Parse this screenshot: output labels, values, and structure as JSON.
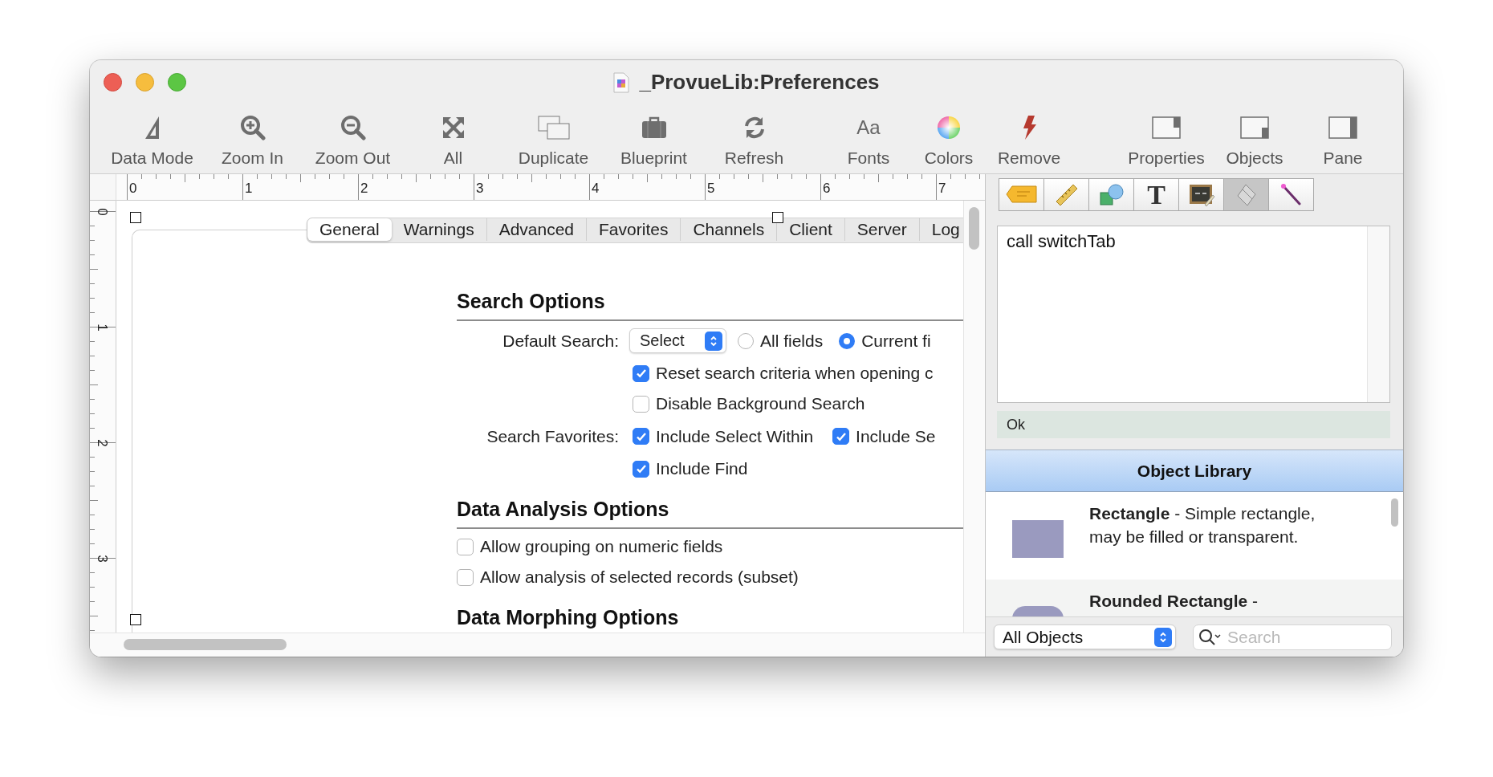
{
  "window": {
    "title": "_ProvueLib:Preferences"
  },
  "toolbar": [
    {
      "label": "Data Mode",
      "kind": "triangle"
    },
    {
      "label": "Zoom In",
      "kind": "zoom_in"
    },
    {
      "label": "Zoom Out",
      "kind": "zoom_out"
    },
    {
      "label": "All",
      "kind": "expand"
    },
    {
      "label": "Duplicate",
      "kind": "duplicate"
    },
    {
      "label": "Blueprint",
      "kind": "briefcase"
    },
    {
      "label": "Refresh",
      "kind": "refresh"
    },
    {
      "label": "Fonts",
      "kind": "fonts",
      "glyph": "Aa"
    },
    {
      "label": "Colors",
      "kind": "colors"
    },
    {
      "label": "Remove",
      "kind": "bolt"
    },
    {
      "label": "Properties",
      "kind": "pane_split"
    },
    {
      "label": "Objects",
      "kind": "pane_lower"
    },
    {
      "label": "Pane",
      "kind": "pane_full"
    }
  ],
  "rulers": {
    "horizontal": [
      "0",
      "1",
      "2",
      "3",
      "4",
      "5",
      "6",
      "7"
    ],
    "vertical": [
      "0",
      "1",
      "2",
      "3"
    ]
  },
  "form": {
    "tabs": [
      {
        "label": "General",
        "selected": true
      },
      {
        "label": "Warnings",
        "selected": false
      },
      {
        "label": "Advanced",
        "selected": false
      },
      {
        "label": "Favorites",
        "selected": false
      },
      {
        "label": "Channels",
        "selected": false
      },
      {
        "label": "Client",
        "selected": false
      },
      {
        "label": "Server",
        "selected": false
      },
      {
        "label": "Log",
        "selected": false
      }
    ],
    "sections": [
      {
        "title": "Search Options",
        "kind": "labeled",
        "rows": [
          {
            "label": "Default Search:",
            "popup": "Select",
            "radios": [
              {
                "label": "All fields",
                "selected": false
              },
              {
                "label": "Current fi",
                "selected": true
              }
            ]
          },
          {
            "checks": [
              {
                "label": "Reset search criteria when opening c",
                "checked": true
              }
            ]
          },
          {
            "checks": [
              {
                "label": "Disable Background Search",
                "checked": false
              }
            ]
          },
          {
            "label": "Search Favorites:",
            "checks": [
              {
                "label": "Include Select Within",
                "checked": true
              },
              {
                "label": "Include Se",
                "checked": true
              }
            ]
          },
          {
            "checks": [
              {
                "label": "Include Find",
                "checked": true
              }
            ]
          }
        ]
      },
      {
        "title": "Data Analysis Options",
        "kind": "plain",
        "rows": [
          {
            "checks": [
              {
                "label": "Allow grouping on numeric fields",
                "checked": false
              }
            ]
          },
          {
            "checks": [
              {
                "label": "Allow analysis of selected records (subset)",
                "checked": false
              }
            ]
          }
        ]
      },
      {
        "title": "Data Morphing Options"
      }
    ]
  },
  "palette": [
    {
      "kind": "tag",
      "selected": false
    },
    {
      "kind": "ruler",
      "selected": false
    },
    {
      "kind": "shapes",
      "selected": false
    },
    {
      "kind": "text",
      "glyph": "T",
      "selected": false
    },
    {
      "kind": "chalkboard",
      "selected": false
    },
    {
      "kind": "eraser",
      "selected": true
    },
    {
      "kind": "wand",
      "selected": false
    }
  ],
  "script_editor": {
    "text": "call switchTab"
  },
  "status": "Ok",
  "object_library": {
    "title": "Object Library",
    "items": [
      {
        "kind": "rectangle",
        "text": "**Rectangle** - Simple rectangle, may be filled or transparent."
      },
      {
        "kind": "rounded_rectangle",
        "text": "**Rounded Rectangle** -"
      }
    ],
    "filter": "All Objects",
    "search": {
      "placeholder": "Search"
    }
  }
}
